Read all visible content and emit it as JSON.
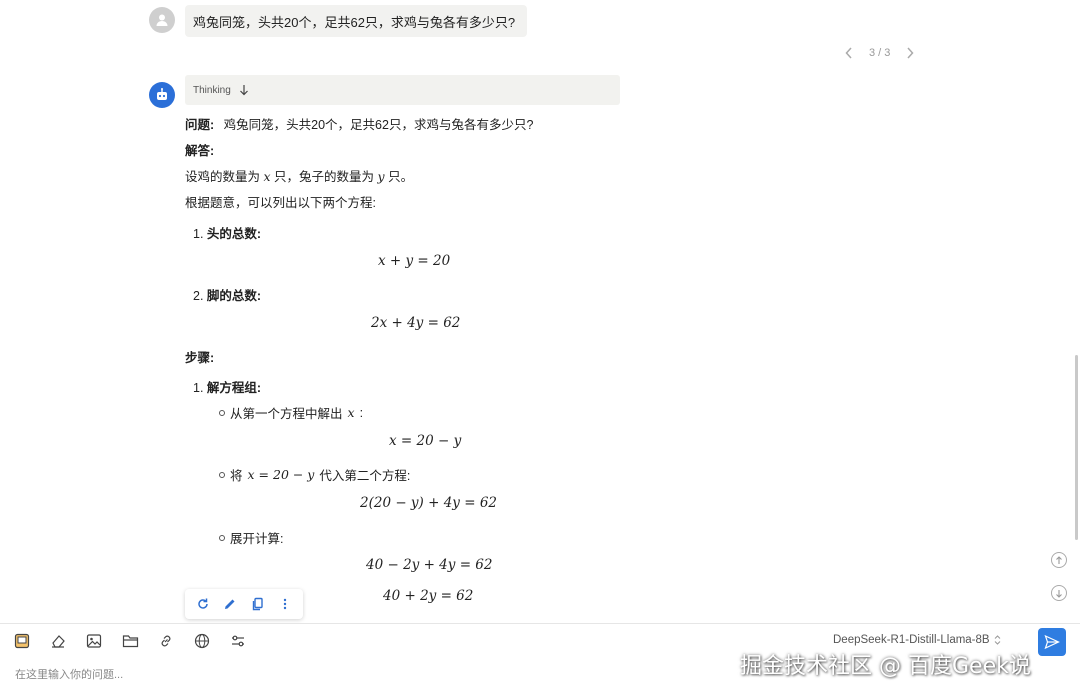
{
  "user_message": "鸡兔同笼，头共20个，足共62只，求鸡与兔各有多少只?",
  "pager": {
    "text": "3 / 3"
  },
  "thinking": {
    "label": "Thinking"
  },
  "answer": {
    "problem_label": "问题:",
    "problem_text": "鸡兔同笼，头共20个，足共62只，求鸡与兔各有多少只?",
    "solution_label": "解答:",
    "assume_prefix": "设鸡的数量为",
    "assume_x": "x",
    "assume_mid": "只，兔子的数量为",
    "assume_y": "y",
    "assume_suffix": "只。",
    "by_question": "根据题意，可以列出以下两个方程:",
    "item1_num": "1.",
    "item1_label": "头的总数:",
    "eq1": "x + y = 20",
    "item2_num": "2.",
    "item2_label": "脚的总数:",
    "eq2": "2x + 4y = 62",
    "steps_label": "步骤:",
    "step1_num": "1.",
    "step1_label": "解方程组:",
    "sub1_text": "从第一个方程中解出",
    "sub1_var": "x",
    "sub1_colon": ":",
    "eq3": "x = 20 − y",
    "sub2_prefix": "将",
    "sub2_math": "x = 20 − y",
    "sub2_suffix": "代入第二个方程:",
    "eq4": "2(20 − y) + 4y = 62",
    "sub3_text": "展开计算:",
    "eq5": "40 − 2y + 4y = 62",
    "eq6": "40 + 2y = 62"
  },
  "composer": {
    "placeholder": "在这里输入你的问题...",
    "model": "DeepSeek-R1-Distill-Llama-8B"
  },
  "watermark": "掘金技术社区 @ 百度Geek说",
  "colors": {
    "accent": "#2f7de1",
    "bot_avatar": "#2b6fd8",
    "bubble": "#f2f2f0"
  }
}
